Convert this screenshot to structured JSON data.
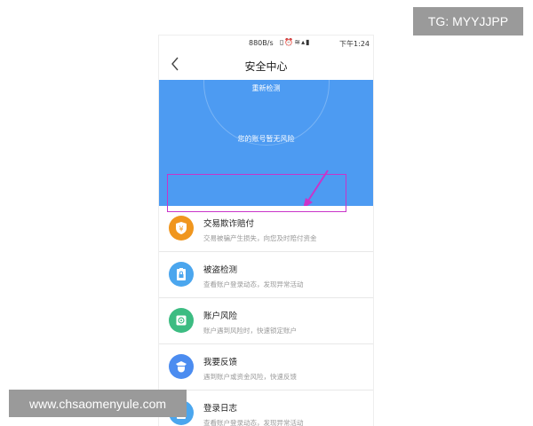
{
  "status_bar": {
    "speed": "880B/s",
    "time": "下午1:24",
    "icons": [
      "vibrate-icon",
      "alarm-icon",
      "wifi-icon",
      "signal-icon",
      "battery-icon"
    ]
  },
  "navbar": {
    "title": "安全中心",
    "back_icon": "chevron-left-icon"
  },
  "banner": {
    "rescan_label": "重新检测",
    "status": "您的账号暂无风险",
    "color": "#4d9bf2"
  },
  "items": [
    {
      "title": "交易欺诈赔付",
      "subtitle": "交易被骗产生损失，向您及时赔付资金",
      "icon": "yen-shield-icon",
      "color": "#f0961e"
    },
    {
      "title": "被盗检测",
      "subtitle": "查看账户登录动态，发现异常活动",
      "icon": "clipboard-lock-icon",
      "color": "#4ba6ee"
    },
    {
      "title": "账户风险",
      "subtitle": "账户遇到风险时，快速锁定账户",
      "icon": "safe-icon",
      "color": "#3cbc82"
    },
    {
      "title": "我要反馈",
      "subtitle": "遇到账户或资金风险，快速反馈",
      "icon": "badge-icon",
      "color": "#4b8cf0"
    },
    {
      "title": "登录日志",
      "subtitle": "查看账户登录动态，发现异常活动",
      "icon": "clipboard-log-icon",
      "color": "#4ba6ee"
    }
  ],
  "watermarks": {
    "tg": "TG: MYYJJPP",
    "site": "www.chsaomenyule.com"
  },
  "annotation": {
    "color": "#c934c9"
  }
}
